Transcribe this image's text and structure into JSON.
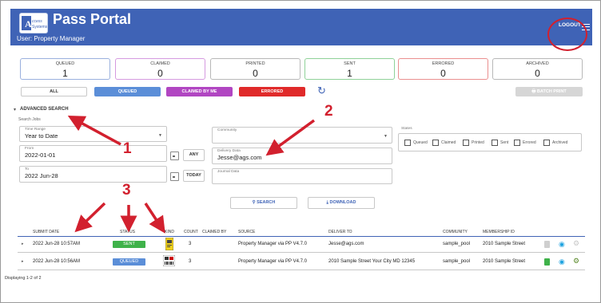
{
  "app": {
    "title": "Pass Portal",
    "user": "User: Property Manager",
    "logout_label": "LOGOUT"
  },
  "status_cards": [
    {
      "label": "QUEUED",
      "value": "1"
    },
    {
      "label": "CLAIMED",
      "value": "0"
    },
    {
      "label": "PRINTED",
      "value": "0"
    },
    {
      "label": "SENT",
      "value": "1"
    },
    {
      "label": "ERRORED",
      "value": "0"
    },
    {
      "label": "ARCHIVED",
      "value": "0"
    }
  ],
  "filter_buttons": {
    "all": "ALL",
    "queued": "QUEUED",
    "claimed_by_me": "CLAIMED BY ME",
    "errored": "ERRORED",
    "batch_print": "BATCH PRINT"
  },
  "advanced_search": {
    "title": "ADVANCED SEARCH",
    "subtitle": "Search Jobs",
    "time_range": {
      "label": "Time Range",
      "value": "Year to Date"
    },
    "from": {
      "label": "From",
      "value": "2022-01-01",
      "button": "ANY"
    },
    "to": {
      "label": "To",
      "value": "2022 Jun-28",
      "button": "TODAY"
    },
    "community": {
      "label": "Community",
      "value": ""
    },
    "delivery_data": {
      "label": "Delivery Data",
      "value": "Jesse@ags.com"
    },
    "journal_data": {
      "label": "Journal Data",
      "value": ""
    },
    "states": {
      "label": "States",
      "options": [
        "Queued",
        "Claimed",
        "Printed",
        "Sent",
        "Errored",
        "Archived"
      ]
    },
    "search_label": "SEARCH",
    "download_label": "DOWNLOAD"
  },
  "table": {
    "headers": [
      "SUBMIT DATE",
      "STATUS",
      "KIND",
      "COUNT",
      "CLAIMED BY",
      "SOURCE",
      "DELIVER TO",
      "COMMUNITY",
      "MEMBERSHIP ID"
    ],
    "rows": [
      {
        "submit_date": "2022 Jun-28 10:57AM",
        "status": "SENT",
        "count": "3",
        "claimed_by": "",
        "source": "Property Manager via PP V4.7.0",
        "deliver_to": "Jesse@ags.com",
        "community": "sample_pool",
        "membership_id": "2010 Sample Street"
      },
      {
        "submit_date": "2022 Jun-28 10:56AM",
        "status": "QUEUED",
        "count": "3",
        "claimed_by": "",
        "source": "Property Manager via PP V4.7.0",
        "deliver_to": "2010 Sample Street Your City MD 12345",
        "community": "sample_pool",
        "membership_id": "2010 Sample Street"
      }
    ],
    "footer": "Displaying 1-2 of 2"
  },
  "annotations": {
    "one": "1",
    "two": "2",
    "three": "3"
  },
  "colors": {
    "topbar": "#3f63b6",
    "queued": "#5b8ed8",
    "claimed": "#b146c2",
    "errored": "#e02a2a",
    "sent": "#3fb24a",
    "annotation": "#d2202e"
  }
}
